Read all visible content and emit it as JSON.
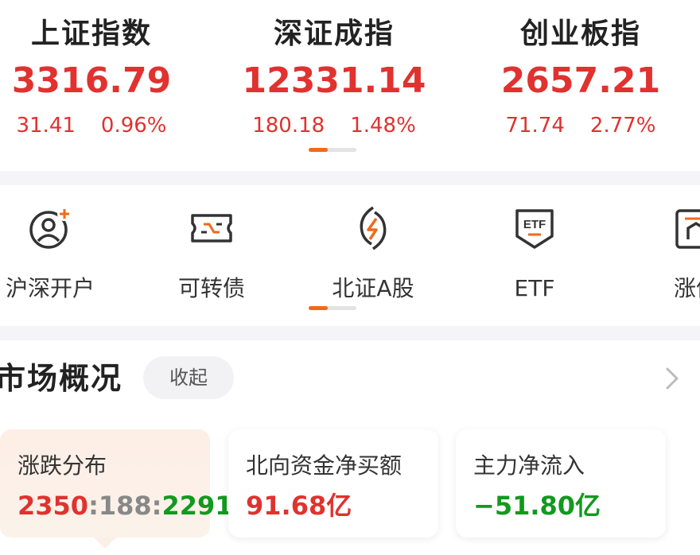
{
  "indices": [
    {
      "name": "上证指数",
      "value": "3316.79",
      "change": "31.41",
      "pct": "0.96%"
    },
    {
      "name": "深证成指",
      "value": "12331.14",
      "change": "180.18",
      "pct": "1.48%"
    },
    {
      "name": "创业板指",
      "value": "2657.21",
      "change": "71.74",
      "pct": "2.77%"
    }
  ],
  "quick_nav": [
    {
      "label": "沪深开户",
      "icon": "user-add-icon"
    },
    {
      "label": "可转债",
      "icon": "ticket-icon"
    },
    {
      "label": "北证A股",
      "icon": "lightning-icon"
    },
    {
      "label": "ETF",
      "icon": "etf-icon"
    },
    {
      "label": "涨停",
      "icon": "limit-up-icon"
    }
  ],
  "overview": {
    "title": "市场概况",
    "collapse_label": "收起",
    "cards": [
      {
        "title": "涨跌分布",
        "up": "2350",
        "sep1": ":",
        "flat": "188",
        "sep2": ":",
        "down": "2291"
      },
      {
        "title": "北向资金净买额",
        "value": "91.68亿"
      },
      {
        "title": "主力净流入",
        "value": "−51.80亿"
      }
    ]
  },
  "colors": {
    "up": "#e0322f",
    "down": "#12991f",
    "accent": "#ee6a1c"
  }
}
